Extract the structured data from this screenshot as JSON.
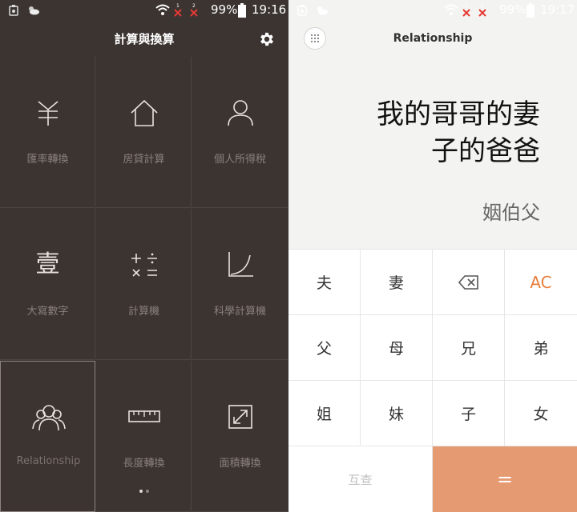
{
  "left": {
    "status": {
      "battery_pct": "99%",
      "time": "19:16"
    },
    "header": {
      "title": "計算與換算"
    },
    "tiles": [
      {
        "label": "匯率轉換",
        "icon": "currency-yen-icon"
      },
      {
        "label": "房貸計算",
        "icon": "house-icon"
      },
      {
        "label": "個人所得稅",
        "icon": "person-icon"
      },
      {
        "label": "大寫數字",
        "icon": "chinese-numeral-icon",
        "glyph": "壹"
      },
      {
        "label": "計算機",
        "icon": "calculator-ops-icon"
      },
      {
        "label": "科學計算機",
        "icon": "function-curve-icon"
      },
      {
        "label": "Relationship",
        "icon": "people-group-icon"
      },
      {
        "label": "長度轉換",
        "icon": "ruler-icon"
      },
      {
        "label": "面積轉換",
        "icon": "expand-arrows-icon"
      }
    ],
    "page_indicator": {
      "pages": 2,
      "current": 1
    }
  },
  "right": {
    "status": {
      "battery_pct": "99%",
      "time": "19:17"
    },
    "title": "Relationship",
    "expression_line1": "我的哥哥的妻",
    "expression_line2": "子的爸爸",
    "result": "姻伯父",
    "keys": {
      "r1": [
        "夫",
        "妻",
        "",
        "AC"
      ],
      "r2": [
        "父",
        "母",
        "兄",
        "弟"
      ],
      "r3": [
        "姐",
        "妹",
        "子",
        "女"
      ],
      "swap": "互查",
      "equals": "="
    },
    "accent_color": "#e59a72"
  }
}
